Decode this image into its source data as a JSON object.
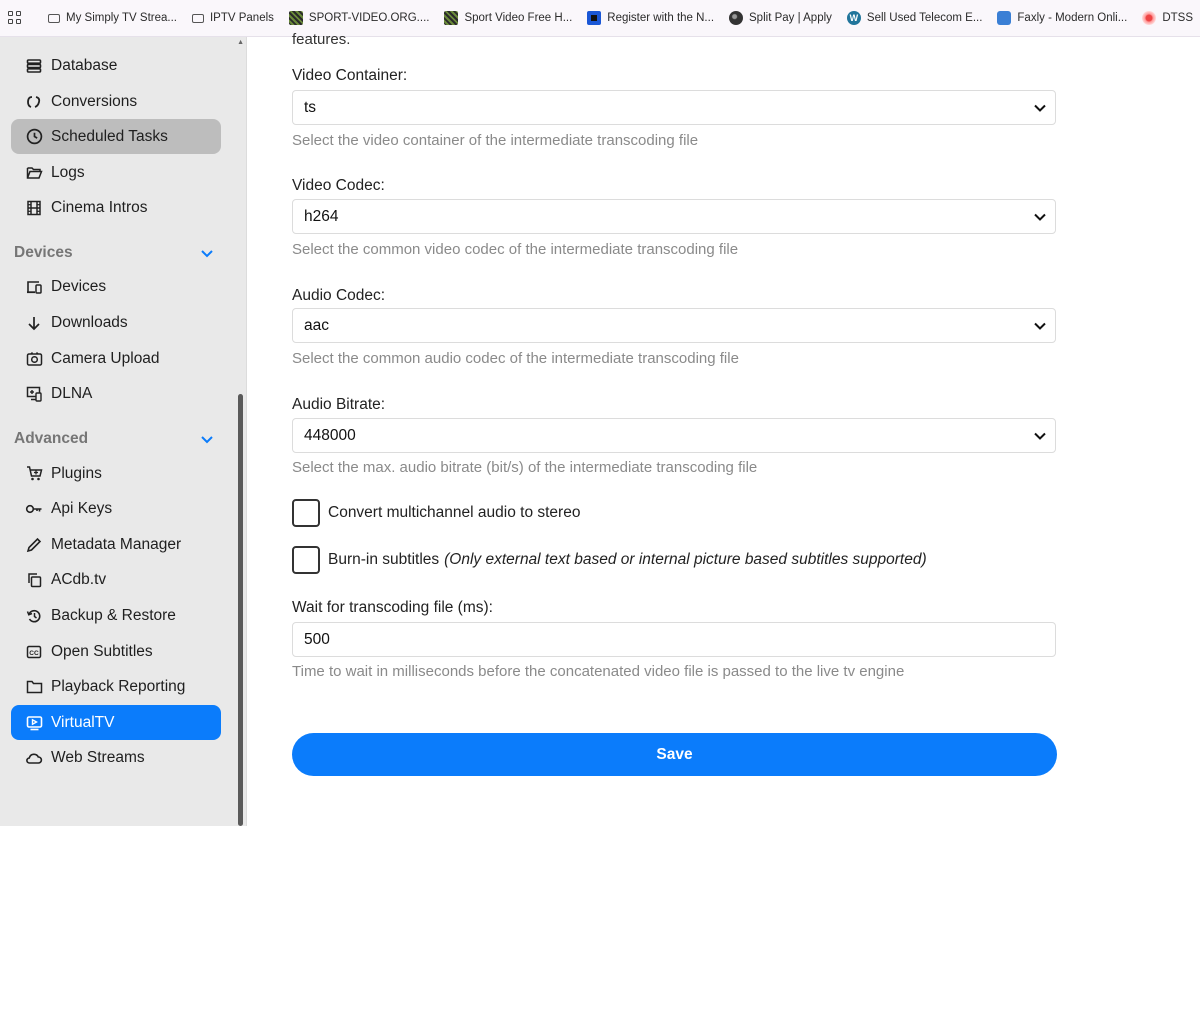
{
  "bookmarks": [
    {
      "label": "My Simply TV Strea...",
      "icon": "folder-icon"
    },
    {
      "label": "IPTV Panels",
      "icon": "folder-icon"
    },
    {
      "label": "SPORT-VIDEO.ORG....",
      "icon": "site-icon"
    },
    {
      "label": "Sport Video Free H...",
      "icon": "site-icon"
    },
    {
      "label": "Register with the N...",
      "icon": "site-icon"
    },
    {
      "label": "Split Pay | Apply",
      "icon": "site-icon"
    },
    {
      "label": "Sell Used Telecom E...",
      "icon": "wordpress-icon"
    },
    {
      "label": "Faxly - Modern Onli...",
      "icon": "site-icon"
    },
    {
      "label": "DTSS",
      "icon": "site-icon"
    }
  ],
  "sidebar": {
    "items_top": [
      {
        "label": "Database",
        "icon": "database-icon"
      },
      {
        "label": "Conversions",
        "icon": "conversions-icon"
      },
      {
        "label": "Scheduled Tasks",
        "icon": "clock-icon"
      },
      {
        "label": "Logs",
        "icon": "folder-open-icon"
      },
      {
        "label": "Cinema Intros",
        "icon": "film-icon"
      }
    ],
    "devices_header": "Devices",
    "devices_items": [
      {
        "label": "Devices",
        "icon": "devices-icon"
      },
      {
        "label": "Downloads",
        "icon": "download-icon"
      },
      {
        "label": "Camera Upload",
        "icon": "camera-icon"
      },
      {
        "label": "DLNA",
        "icon": "dlna-icon"
      }
    ],
    "advanced_header": "Advanced",
    "advanced_items": [
      {
        "label": "Plugins",
        "icon": "cart-icon"
      },
      {
        "label": "Api Keys",
        "icon": "key-icon"
      },
      {
        "label": "Metadata Manager",
        "icon": "pencil-icon"
      },
      {
        "label": "ACdb.tv",
        "icon": "copy-icon"
      },
      {
        "label": "Backup & Restore",
        "icon": "restore-icon"
      },
      {
        "label": "Open Subtitles",
        "icon": "cc-icon"
      },
      {
        "label": "Playback Reporting",
        "icon": "folder-icon"
      },
      {
        "label": "VirtualTV",
        "icon": "play-screen-icon"
      },
      {
        "label": "Web Streams",
        "icon": "cloud-icon"
      }
    ]
  },
  "form": {
    "cutoff_text": "features.",
    "video_container": {
      "label": "Video Container:",
      "value": "ts",
      "help": "Select the video container of the intermediate transcoding file"
    },
    "video_codec": {
      "label": "Video Codec:",
      "value": "h264",
      "help": "Select the common video codec of the intermediate transcoding file"
    },
    "audio_codec": {
      "label": "Audio Codec:",
      "value": "aac",
      "help": "Select the common audio codec of the intermediate transcoding file"
    },
    "audio_bitrate": {
      "label": "Audio Bitrate:",
      "value": "448000",
      "help": "Select the max. audio bitrate (bit/s) of the intermediate transcoding file"
    },
    "convert_stereo": {
      "label": "Convert multichannel audio to stereo",
      "checked": false
    },
    "burn_in": {
      "label": "Burn-in subtitles",
      "hint": "(Only external text based or internal picture based subtitles supported)",
      "checked": false
    },
    "wait": {
      "label": "Wait for transcoding file (ms):",
      "value": "500",
      "help": "Time to wait in milliseconds before the concatenated video file is passed to the live tv engine"
    },
    "save_label": "Save"
  },
  "colors": {
    "accent": "#0b7cfb",
    "sidebar_bg": "#e9e9e9",
    "selected_bg": "#bdbdbd"
  }
}
